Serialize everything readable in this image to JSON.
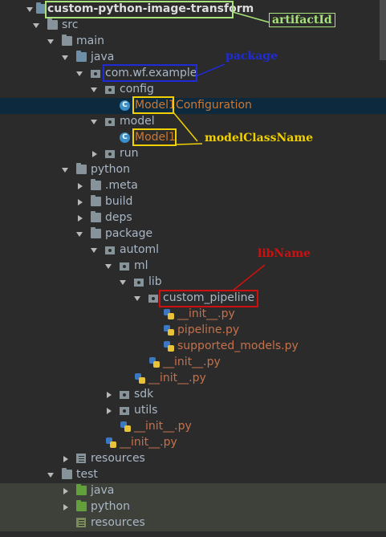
{
  "tree": {
    "root": "custom-python-image-transform",
    "src": "src",
    "main": "main",
    "java": "java",
    "package_name": "com.wf.example",
    "config": "config",
    "model1_prefix": "Model1",
    "model1_configuration_suffix": "Configuration",
    "model": "model",
    "model1": "Model1",
    "run": "run",
    "python": "python",
    "meta": ".meta",
    "build": "build",
    "deps": "deps",
    "package_dir": "package",
    "automl": "automl",
    "ml": "ml",
    "lib": "lib",
    "custom_pipeline": "custom_pipeline",
    "init_py_1": "__init__.py",
    "pipeline_py": "pipeline.py",
    "supported_models_py": "supported_models.py",
    "init_py_2": "__init__.py",
    "init_py_3": "__init__.py",
    "sdk": "sdk",
    "utils": "utils",
    "init_py_4": "__init__.py",
    "init_py_5": "__init__.py",
    "resources": "resources",
    "test": "test",
    "test_java": "java",
    "test_python": "python",
    "test_resources": "resources"
  },
  "annotations": {
    "artifactId": "artifactId",
    "package": "package",
    "modelClassName": "modelClassName",
    "libName": "libName"
  },
  "colors": {
    "background": "#2b2b2b",
    "selected_row": "#0d293e",
    "artifact_annotation": "#a8e27a",
    "package_annotation": "#1f2bd6",
    "model_annotation": "#f0d000",
    "lib_annotation": "#d01010"
  }
}
